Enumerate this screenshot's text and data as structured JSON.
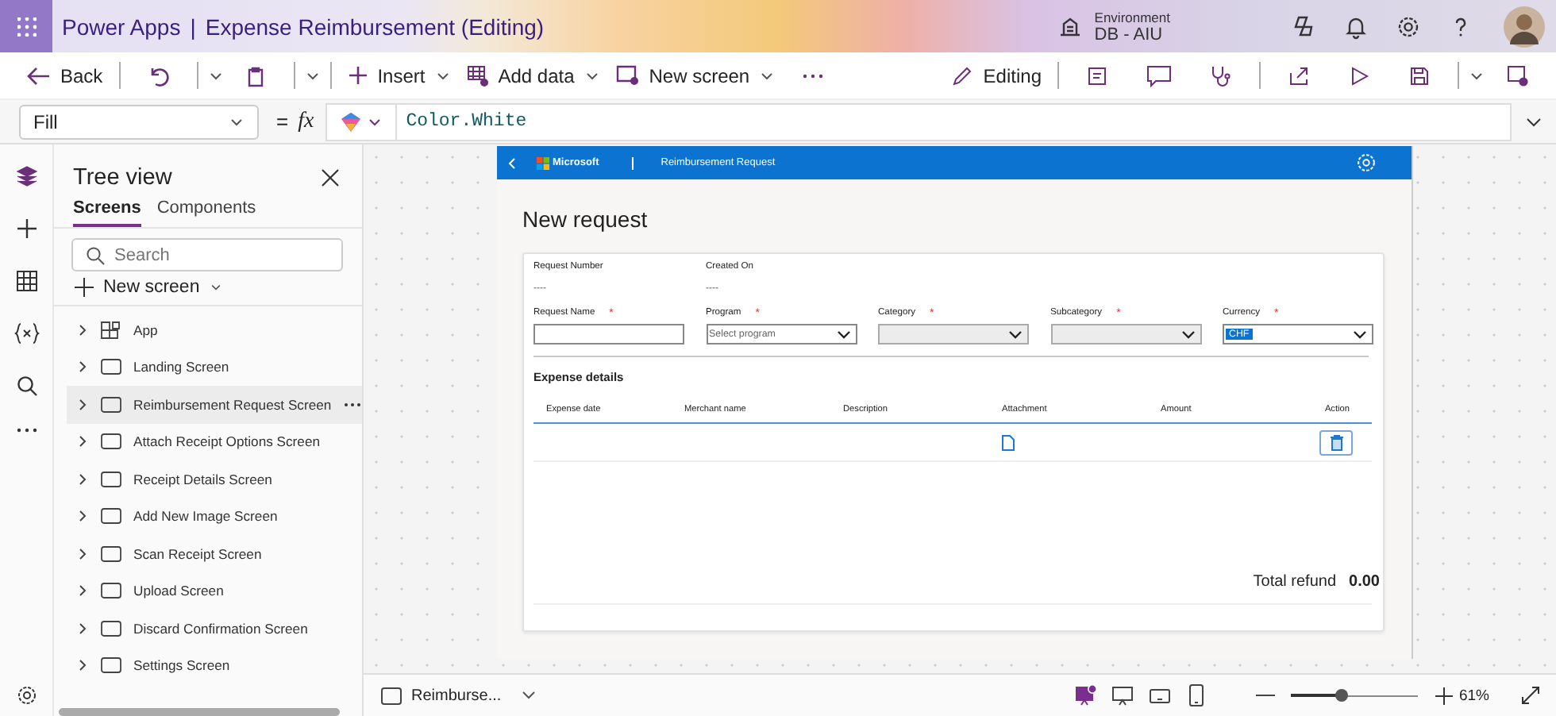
{
  "header": {
    "app_name": "Power Apps",
    "separator": "|",
    "document_title": "Expense Reimbursement (Editing)",
    "environment_label": "Environment",
    "environment_name": "DB - AIU"
  },
  "toolbar": {
    "back": "Back",
    "insert": "Insert",
    "add_data": "Add data",
    "new_screen": "New screen",
    "mode": "Editing"
  },
  "formula_bar": {
    "property": "Fill",
    "equals": "=",
    "fx": "fx",
    "formula": "Color.White"
  },
  "tree_view": {
    "title": "Tree view",
    "tabs": [
      {
        "label": "Screens",
        "selected": true
      },
      {
        "label": "Components",
        "selected": false
      }
    ],
    "search": {
      "placeholder": "Search"
    },
    "new_screen": "New screen",
    "items": [
      {
        "label": "App",
        "kind": "app",
        "selected": false
      },
      {
        "label": "Landing Screen",
        "kind": "screen",
        "selected": false
      },
      {
        "label": "Reimbursement Request Screen",
        "kind": "screen",
        "selected": true
      },
      {
        "label": "Attach Receipt Options Screen",
        "kind": "screen",
        "selected": false
      },
      {
        "label": "Receipt Details Screen",
        "kind": "screen",
        "selected": false
      },
      {
        "label": "Add New Image Screen",
        "kind": "screen",
        "selected": false
      },
      {
        "label": "Scan Receipt Screen",
        "kind": "screen",
        "selected": false
      },
      {
        "label": "Upload Screen",
        "kind": "screen",
        "selected": false
      },
      {
        "label": "Discard Confirmation Screen",
        "kind": "screen",
        "selected": false
      },
      {
        "label": "Settings Screen",
        "kind": "screen",
        "selected": false
      }
    ]
  },
  "app_screen": {
    "brand": "Microsoft",
    "title": "Reimbursement Request",
    "heading": "New request",
    "info": [
      {
        "label": "Request Number",
        "value": "----"
      },
      {
        "label": "Created On",
        "value": "----"
      }
    ],
    "fields": [
      {
        "label": "Request Name",
        "required_mark": "*",
        "kind": "text"
      },
      {
        "label": "Program",
        "required_mark": "*",
        "kind": "dropdown",
        "placeholder": "Select program",
        "disabled": false
      },
      {
        "label": "Category",
        "required_mark": "*",
        "kind": "dropdown",
        "disabled": true
      },
      {
        "label": "Subcategory",
        "required_mark": "*",
        "kind": "dropdown",
        "disabled": true
      },
      {
        "label": "Currency",
        "required_mark": "*",
        "kind": "dropdown",
        "value": "CHF",
        "disabled": false
      }
    ],
    "section_title": "Expense details",
    "columns": [
      "Expense date",
      "Merchant name",
      "Description",
      "Attachment",
      "Amount",
      "Action"
    ],
    "total_label": "Total refund",
    "total_value": "0.00"
  },
  "status_bar": {
    "screen": "Reimburse...",
    "views": [
      {
        "kind": "app",
        "selected": true
      },
      {
        "kind": "desktop",
        "selected": false
      },
      {
        "kind": "tablet",
        "selected": false
      },
      {
        "kind": "phone",
        "selected": false
      }
    ],
    "zoom_slider": {
      "level": 0.4
    },
    "zoom": "61%"
  }
}
